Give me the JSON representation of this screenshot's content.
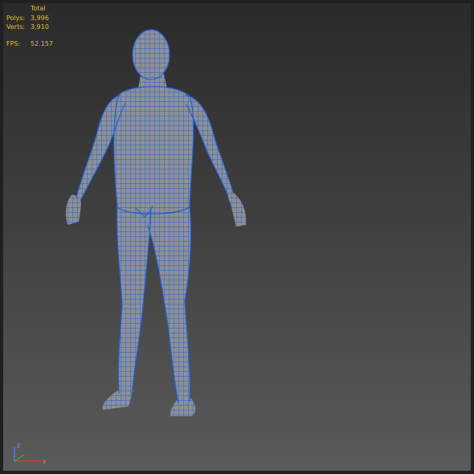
{
  "viewport_stats": {
    "total_label": "Total",
    "polys_label": "Polys:",
    "polys_value": "3,996",
    "verts_label": "Verts:",
    "verts_value": "3,910",
    "fps_label": "FPS:",
    "fps_value": "52.157"
  },
  "axis_gizmo": {
    "z_label": "z",
    "x_label": "x"
  },
  "colors": {
    "background_top": "#2a2a2a",
    "background_bottom": "#5b5b5b",
    "stats_text": "#f0c23a",
    "wire": "#1f5fd8",
    "mesh": "#8e9094"
  },
  "model": {
    "icon": "wireframe-human-body-icon"
  }
}
